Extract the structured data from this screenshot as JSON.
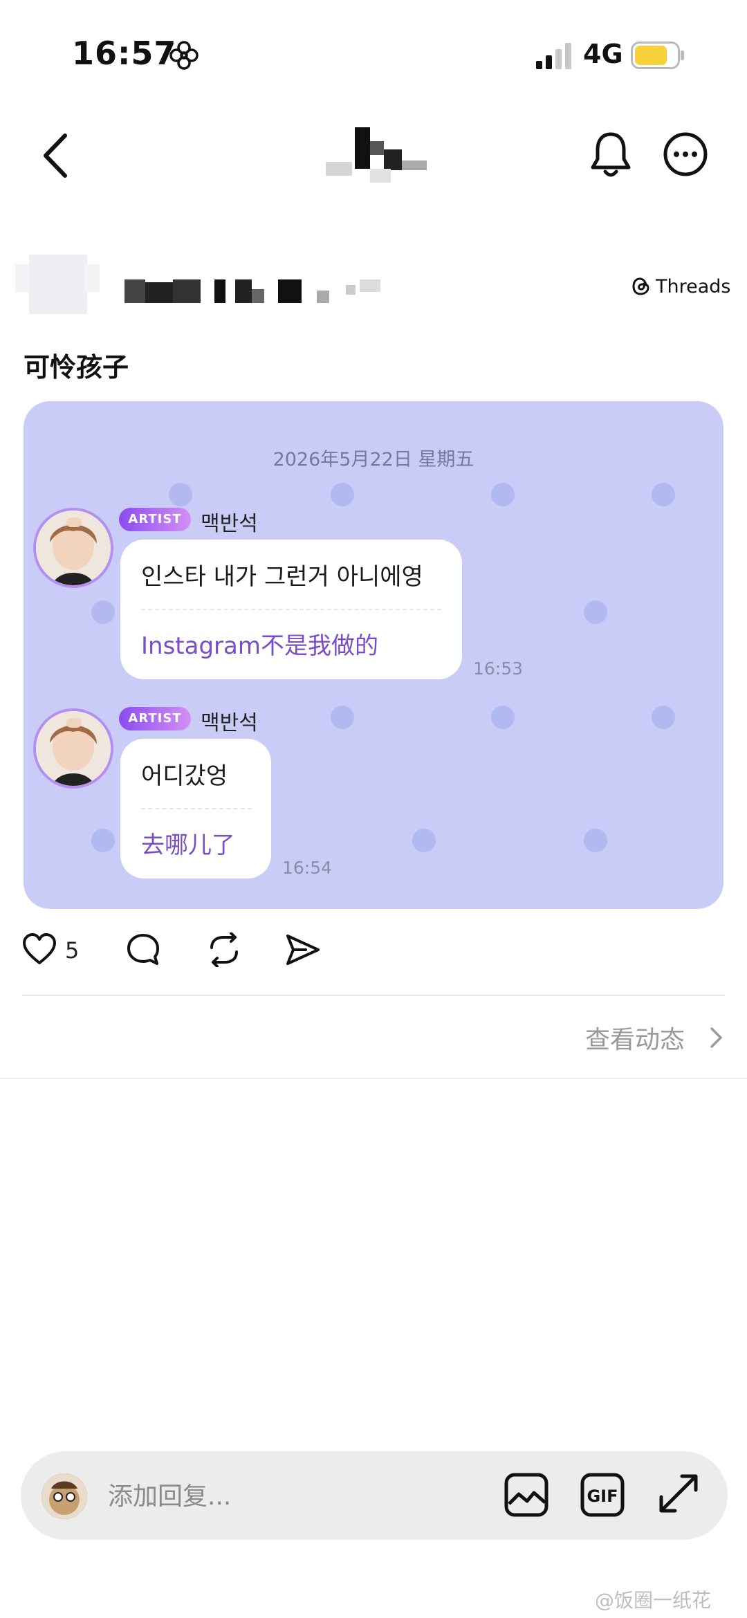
{
  "status_bar": {
    "time": "16:57",
    "network": "4G",
    "battery_color": "#f8d23a"
  },
  "nav": {
    "title_blurred": true
  },
  "post": {
    "source_label": "Threads",
    "text": "可怜孩子",
    "like_count": "5",
    "view_activity_label": "查看动态"
  },
  "chat": {
    "date": "2026年5月22日 星期五",
    "messages": [
      {
        "badge": "ARTIST",
        "name": "맥반석",
        "korean": "인스타 내가 그런거 아니에영",
        "translation": "Instagram不是我做的",
        "time": "16:53"
      },
      {
        "badge": "ARTIST",
        "name": "맥반석",
        "korean": "어디갔엉",
        "translation": "去哪儿了",
        "time": "16:54"
      }
    ],
    "background_color": "#c9ccf6",
    "accent_color": "#7a4cc7"
  },
  "reply": {
    "placeholder": "添加回复..."
  },
  "watermark": "@饭圈一纸花"
}
